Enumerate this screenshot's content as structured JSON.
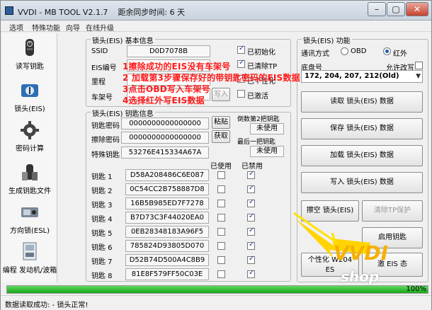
{
  "window": {
    "title": "VVDI - MB TOOL V2.1.7",
    "sync_time": "距余同步时间: 6 天"
  },
  "menu": [
    "选项",
    "特殊功能",
    "向导",
    "在线升级"
  ],
  "sidebar": [
    {
      "label": "读写钥匙",
      "icon": "mercedes-key-icon"
    },
    {
      "label": "锁头(EIS)",
      "icon": "eis-ignition-icon"
    },
    {
      "label": "密码计算",
      "icon": "gear-calc-icon"
    },
    {
      "label": "生成钥匙文件",
      "icon": "key-file-icon"
    },
    {
      "label": "方向锁(ESL)",
      "icon": "steering-lock-icon"
    },
    {
      "label": "编程 发动机/波箱",
      "icon": "engine-ecu-icon"
    }
  ],
  "eis_basic": {
    "title": "锁头(EIS) 基本信息",
    "ssid_label": "SSID",
    "ssid_value": "D0D7078B",
    "eis_no_label": "EIS编号",
    "mileage_label": "里程",
    "vin_label": "车架号",
    "write_button": "写入",
    "checks": [
      {
        "label": "已初始化",
        "checked": true
      },
      {
        "label": "已清除TP",
        "checked": true
      },
      {
        "label": "已个性化",
        "checked": false
      },
      {
        "label": "已激活",
        "checked": false
      }
    ]
  },
  "annotations": [
    "1擦除成功的EIS没有车架号",
    "2 加载第3步骤保存好的带钥匙密码的EIS数据",
    "3点击OBD写入车架号",
    "4选择红外写EIS数据"
  ],
  "key_info": {
    "title": "锁头(EIS) 钥匙信息",
    "key_password_label": "钥匙密码",
    "key_password_value": "0000000000000000",
    "paste_button": "粘贴",
    "erase_password_label": "擦除密码",
    "erase_password_value": "0000000000000000",
    "fetch_button": "获取",
    "special_key_label": "特殊钥匙",
    "special_key_value": "53276E415334A67A",
    "pos_label_1": "倒数第2把钥匙",
    "pos_value_1": "未使用",
    "pos_label_2": "最后一把钥匙",
    "pos_value_2": "未使用",
    "used_header": "已使用",
    "disabled_header": "已禁用",
    "keys": [
      {
        "label": "钥匙 1",
        "value": "D58A208486C6E087",
        "used": false,
        "disabled": true
      },
      {
        "label": "钥匙 2",
        "value": "0C54CC2B758887D8",
        "used": false,
        "disabled": true
      },
      {
        "label": "钥匙 3",
        "value": "16B5B985ED7F7278",
        "used": false,
        "disabled": true
      },
      {
        "label": "钥匙 4",
        "value": "B7D73C3F44020EA0",
        "used": false,
        "disabled": true
      },
      {
        "label": "钥匙 5",
        "value": "0EB28348183A96F5",
        "used": false,
        "disabled": true
      },
      {
        "label": "钥匙 6",
        "value": "785824D93805D070",
        "used": false,
        "disabled": true
      },
      {
        "label": "钥匙 7",
        "value": "D52B74D500A4C8B9",
        "used": false,
        "disabled": true
      },
      {
        "label": "钥匙 8",
        "value": "81E8F579FF50C03E",
        "used": false,
        "disabled": true
      }
    ]
  },
  "eis_func": {
    "title": "锁头(EIS) 功能",
    "comm_label": "通讯方式",
    "obd_label": "OBD",
    "ir_label": "红外",
    "selected": "ir",
    "chassis_label": "底盘号",
    "allow_modify_label": "允许改写",
    "chassis_value": "172, 204, 207, 212(Old)",
    "read_button": "读取 锁头(EIS) 数据",
    "save_button": "保存 锁头(EIS) 数据",
    "load_button": "加载 锁头(EIS) 数据",
    "write_button": "写入 锁头(EIS) 数据",
    "erase_button": "擦空 锁头(EIS)",
    "clear_tp_button": "清除TP保护",
    "activate_key_button": "启用钥匙",
    "personalize_button_a": "个性化 W204\nES",
    "personalize_button_b": "激 EIS 态"
  },
  "progress": {
    "percent": 100,
    "label": "100%"
  },
  "status": {
    "text": "数据读取成功: - 锁头正常!"
  },
  "watermark": {
    "brand": "VVDI",
    "sub": "shop"
  }
}
